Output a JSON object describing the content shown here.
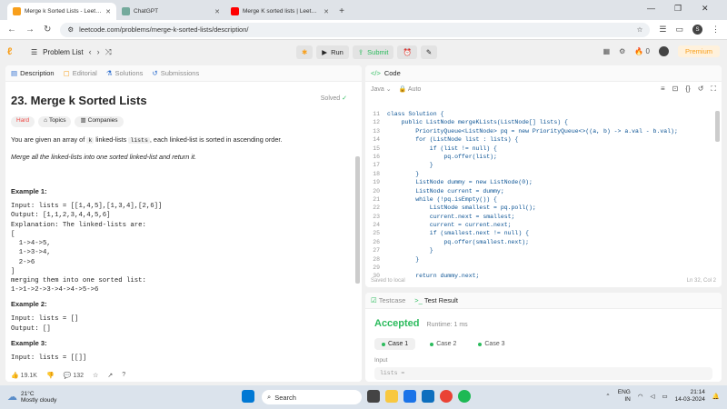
{
  "browser": {
    "tabs": [
      {
        "title": "Merge k Sorted Lists - LeetCode",
        "color": "#f89f1b",
        "active": true
      },
      {
        "title": "ChatGPT",
        "color": "#74aa9c",
        "active": false
      },
      {
        "title": "Merge K sorted lists | Leetcode",
        "color": "#ff0000",
        "active": false
      }
    ],
    "url": "leetcode.com/problems/merge-k-sorted-lists/description/",
    "profile_initial": "S"
  },
  "topbar": {
    "problem_list": "Problem List",
    "run": "Run",
    "submit": "Submit",
    "coins": "0",
    "premium": "Premium"
  },
  "left_tabs": [
    "Description",
    "Editorial",
    "Solutions",
    "Submissions"
  ],
  "problem": {
    "title": "23. Merge k Sorted Lists",
    "solved": "Solved",
    "difficulty": "Hard",
    "topics": "Topics",
    "companies": "Companies",
    "desc_1": "You are given an array of",
    "desc_k": "k",
    "desc_2": "linked-lists",
    "desc_lists": "lists",
    "desc_3": ", each linked-list is sorted in ascending order.",
    "desc_italic": "Merge all the linked-lists into one sorted linked-list and return it.",
    "ex1_h": "Example 1:",
    "ex1_body": "Input: lists = [[1,4,5],[1,3,4],[2,6]]\nOutput: [1,1,2,3,4,4,5,6]\nExplanation: The linked-lists are:\n[\n  1->4->5,\n  1->3->4,\n  2->6\n]\nmerging them into one sorted list:\n1->1->2->3->4->4->5->6",
    "ex2_h": "Example 2:",
    "ex2_body": "Input: lists = []\nOutput: []",
    "ex3_h": "Example 3:",
    "ex3_body": "Input: lists = [[]]"
  },
  "left_footer": {
    "likes": "19.1K",
    "comments": "132"
  },
  "code": {
    "tab": "Code",
    "language": "Java",
    "auto": "Auto",
    "lines": [
      {
        "n": "11",
        "t": "class Solution {"
      },
      {
        "n": "12",
        "t": "    public ListNode mergeKLists(ListNode[] lists) {"
      },
      {
        "n": "13",
        "t": "        PriorityQueue<ListNode> pq = new PriorityQueue<>((a, b) -> a.val - b.val);"
      },
      {
        "n": "14",
        "t": "        for (ListNode list : lists) {"
      },
      {
        "n": "15",
        "t": "            if (list != null) {"
      },
      {
        "n": "16",
        "t": "                pq.offer(list);"
      },
      {
        "n": "17",
        "t": "            }"
      },
      {
        "n": "18",
        "t": "        }"
      },
      {
        "n": "19",
        "t": "        ListNode dummy = new ListNode(0);"
      },
      {
        "n": "20",
        "t": "        ListNode current = dummy;"
      },
      {
        "n": "21",
        "t": "        while (!pq.isEmpty()) {"
      },
      {
        "n": "22",
        "t": "            ListNode smallest = pq.poll();"
      },
      {
        "n": "23",
        "t": "            current.next = smallest;"
      },
      {
        "n": "24",
        "t": "            current = current.next;"
      },
      {
        "n": "25",
        "t": "            if (smallest.next != null) {"
      },
      {
        "n": "26",
        "t": "                pq.offer(smallest.next);"
      },
      {
        "n": "27",
        "t": "            }"
      },
      {
        "n": "28",
        "t": "        }"
      },
      {
        "n": "29",
        "t": ""
      },
      {
        "n": "30",
        "t": "        return dummy.next;"
      }
    ],
    "saved": "Saved to local",
    "cursor": "Ln 32, Col 2"
  },
  "testpanel": {
    "testcase": "Testcase",
    "result": "Test Result",
    "status": "Accepted",
    "runtime": "Runtime: 1 ms",
    "cases": [
      "Case 1",
      "Case 2",
      "Case 3"
    ],
    "input_label": "Input",
    "input_val": "lists ="
  },
  "taskbar": {
    "temp": "21°C",
    "weather": "Mostly cloudy",
    "search": "Search",
    "lang1": "ENG",
    "lang2": "IN",
    "time": "21:14",
    "date": "14-03-2024"
  }
}
